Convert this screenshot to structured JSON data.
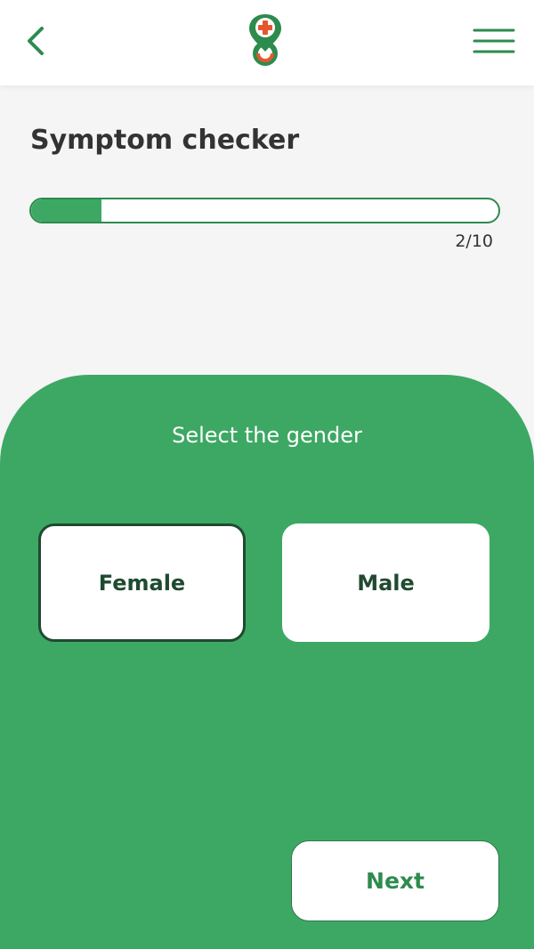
{
  "header": {
    "back_icon": "chevron-left-icon",
    "logo_icon": "location-pin-medical-cross-icon",
    "menu_icon": "hamburger-menu-icon"
  },
  "page": {
    "title": "Symptom checker"
  },
  "progress": {
    "current": 2,
    "total": 10,
    "label": "2/10",
    "fraction": 0.15
  },
  "question": {
    "prompt": "Select the gender",
    "options": [
      {
        "label": "Female",
        "selected": true
      },
      {
        "label": "Male",
        "selected": false
      }
    ]
  },
  "actions": {
    "next_label": "Next"
  },
  "colors": {
    "accent_green": "#3da864",
    "dark_green": "#1f4a30",
    "logo_red": "#e4572e",
    "background": "#f5f5f5"
  }
}
